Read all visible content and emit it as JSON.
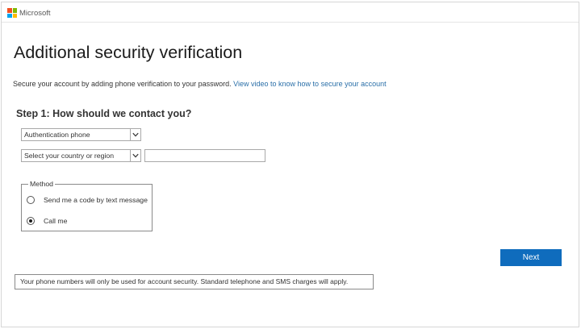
{
  "header": {
    "brand": "Microsoft",
    "logo_colors": [
      "#f25022",
      "#7fba00",
      "#00a4ef",
      "#ffb900"
    ]
  },
  "page": {
    "title": "Additional security verification",
    "intro_text": "Secure your account by adding phone verification to your password. ",
    "intro_link": "View video to know how to secure your account"
  },
  "step": {
    "heading": "Step 1: How should we contact you?"
  },
  "form": {
    "contact_method_selected": "Authentication phone",
    "country_selected": "Select your country or region",
    "phone_value": "",
    "method": {
      "legend": "Method",
      "options": [
        {
          "label": "Send me a code by text message",
          "checked": false
        },
        {
          "label": "Call me",
          "checked": true
        }
      ]
    }
  },
  "actions": {
    "next_label": "Next",
    "accent": "#0f6cbd"
  },
  "footer": {
    "notice": "Your phone numbers will only be used for account security. Standard telephone and SMS charges will apply."
  }
}
